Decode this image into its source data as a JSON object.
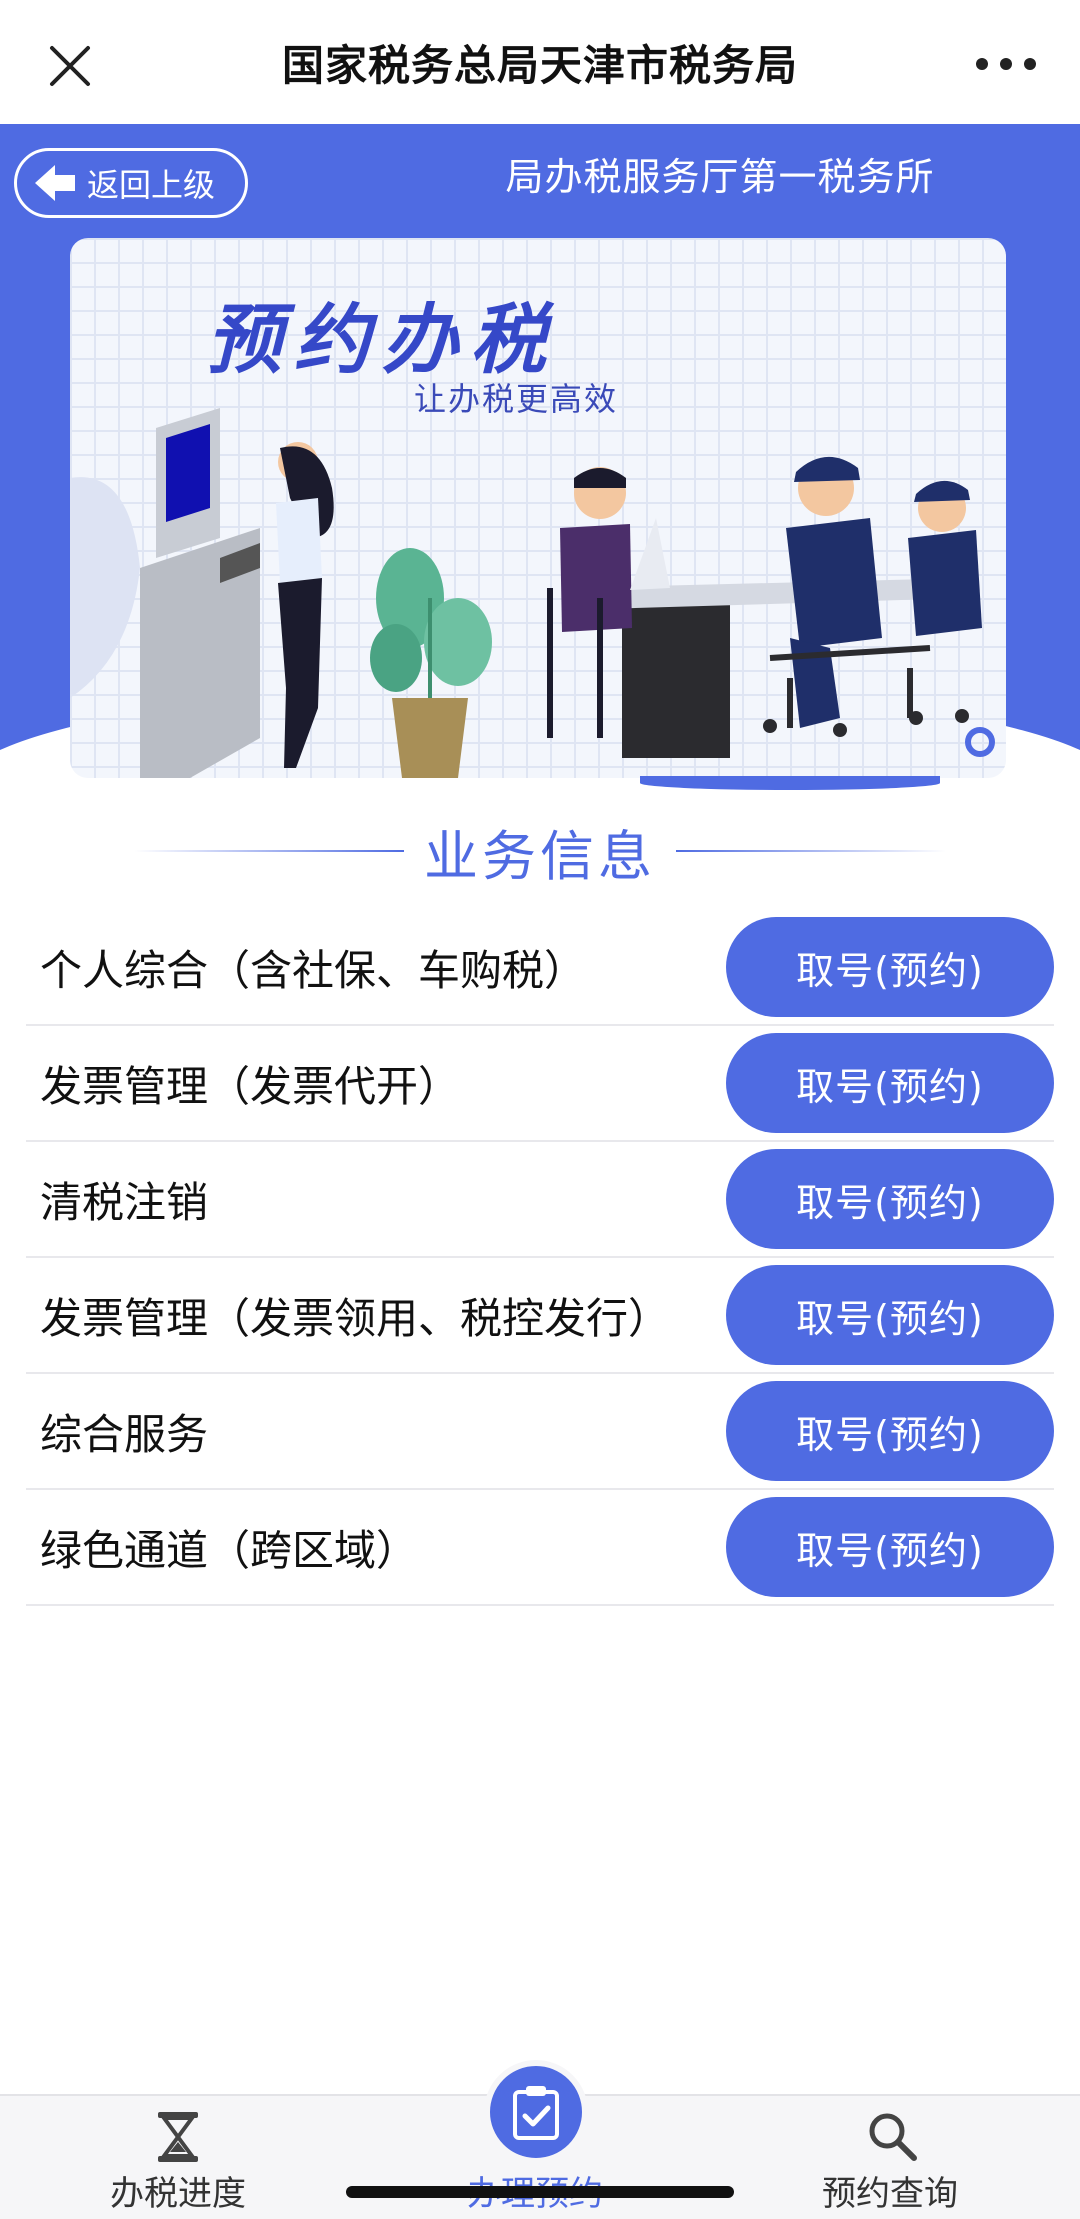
{
  "header": {
    "close_icon": "close-icon",
    "title": "国家税务总局天津市税务局",
    "more_icon": "more-icon"
  },
  "hero": {
    "back_label": "返回上级",
    "office_name": "局办税服务厅第一税务所",
    "banner_headline": "预约办税",
    "banner_subtitle": "让办税更高效"
  },
  "section": {
    "title": "业务信息"
  },
  "services": [
    {
      "name": "个人综合（含社保、车购税）",
      "button": "取号(预约)"
    },
    {
      "name": "发票管理（发票代开）",
      "button": "取号(预约)"
    },
    {
      "name": "清税注销",
      "button": "取号(预约)"
    },
    {
      "name": "发票管理（发票领用、税控发行）",
      "button": "取号(预约)"
    },
    {
      "name": "综合服务",
      "button": "取号(预约)"
    },
    {
      "name": "绿色通道（跨区域）",
      "button": "取号(预约)"
    }
  ],
  "tabbar": {
    "progress": {
      "label": "办税进度",
      "icon": "hourglass-icon"
    },
    "book": {
      "label": "办理预约",
      "icon": "clipboard-check-icon"
    },
    "query": {
      "label": "预约查询",
      "icon": "search-icon"
    }
  },
  "colors": {
    "accent": "#4f6be2",
    "background": "#ffffff",
    "text": "#111111"
  }
}
